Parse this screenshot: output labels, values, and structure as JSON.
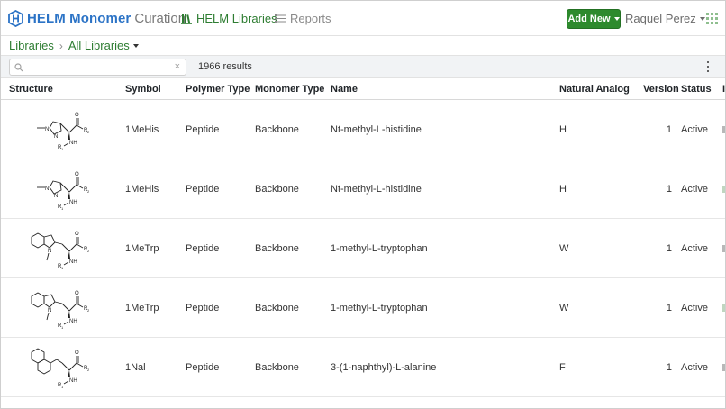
{
  "brand": {
    "name_strong": "HELM Monomer",
    "name_light": "Curation"
  },
  "nav": {
    "libraries": "HELM Libraries",
    "reports": "Reports"
  },
  "header": {
    "add_new": "Add New",
    "user": "Raquel Perez"
  },
  "breadcrumb": {
    "root": "Libraries",
    "separator": "›",
    "current": "All Libraries"
  },
  "toolbar": {
    "search_value": "",
    "search_placeholder": "",
    "clear": "×",
    "results": "1966 results"
  },
  "table": {
    "columns": {
      "structure": "Structure",
      "symbol": "Symbol",
      "polymer_type": "Polymer Type",
      "monomer_type": "Monomer Type",
      "name": "Name",
      "natural_analog": "Natural Analog",
      "version": "Version",
      "status": "Status",
      "more": "I"
    },
    "rows": [
      {
        "structure": "imidazole",
        "symbol": "1MeHis",
        "polymer_type": "Peptide",
        "monomer_type": "Backbone",
        "name": "Nt-methyl-L-histidine",
        "natural_analog": "H",
        "version": "1",
        "status": "Active"
      },
      {
        "structure": "imidazole",
        "symbol": "1MeHis",
        "polymer_type": "Peptide",
        "monomer_type": "Backbone",
        "name": "Nt-methyl-L-histidine",
        "natural_analog": "H",
        "version": "1",
        "status": "Active"
      },
      {
        "structure": "indole",
        "symbol": "1MeTrp",
        "polymer_type": "Peptide",
        "monomer_type": "Backbone",
        "name": "1-methyl-L-tryptophan",
        "natural_analog": "W",
        "version": "1",
        "status": "Active"
      },
      {
        "structure": "indole",
        "symbol": "1MeTrp",
        "polymer_type": "Peptide",
        "monomer_type": "Backbone",
        "name": "1-methyl-L-tryptophan",
        "natural_analog": "W",
        "version": "1",
        "status": "Active"
      },
      {
        "structure": "naphthyl",
        "symbol": "1Nal",
        "polymer_type": "Peptide",
        "monomer_type": "Backbone",
        "name": "3-(1-naphthyl)-L-alanine",
        "natural_analog": "F",
        "version": "1",
        "status": "Active"
      }
    ]
  },
  "colors": {
    "brand_blue": "#2b73c6",
    "nav_green": "#2e7d32",
    "button_green": "#2d8a2d"
  }
}
